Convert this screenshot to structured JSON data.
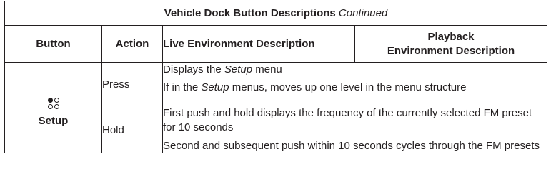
{
  "title": {
    "main": "Vehicle Dock Button Descriptions",
    "suffix": "Continued"
  },
  "headers": {
    "button": "Button",
    "action": "Action",
    "live": "Live Environment Description",
    "playback_line1": "Playback",
    "playback_line2": "Environment Description"
  },
  "row": {
    "button_icon": "setup-four-dots-icon",
    "button_label": "Setup",
    "press": {
      "action": "Press",
      "line1_pre": "Displays the ",
      "line1_italic": "Setup",
      "line1_post": " menu",
      "line2_pre": "If in the ",
      "line2_italic": "Setup",
      "line2_post": " menus, moves up one level in the menu structure"
    },
    "hold": {
      "action": "Hold",
      "line1": "First push and hold displays the frequency of the currently selected FM preset for 10 seconds",
      "line2": "Second and subsequent push within 10 seconds cycles through the FM presets"
    }
  }
}
